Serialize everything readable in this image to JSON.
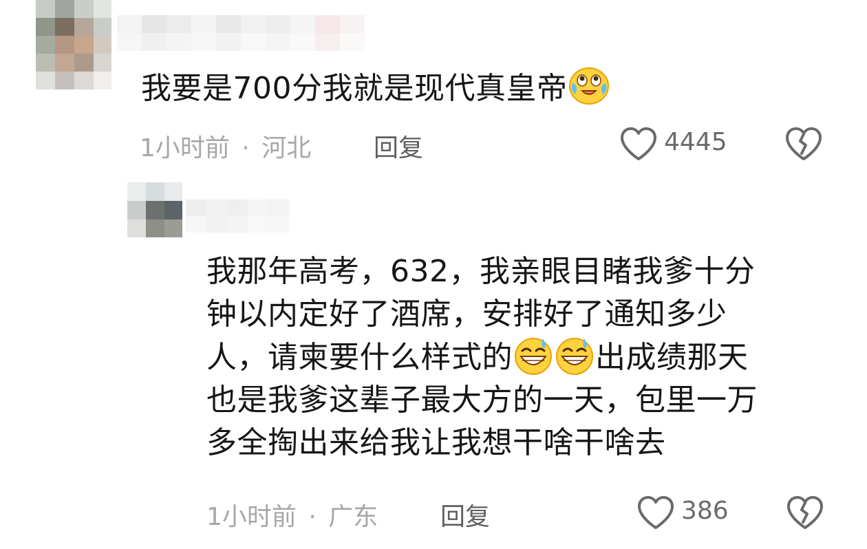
{
  "comments": [
    {
      "text_before_emoji": "我要是700分我就是现代真皇帝",
      "emoji": "laughing-crying-face",
      "time": "1小时前",
      "dot": "·",
      "location": "河北",
      "reply_label": "回复",
      "likes": "4445"
    },
    {
      "line1": "我那年高考，632，我亲眼目睹我爹十分",
      "line2": "钟以内定好了酒席，安排好了通知多少",
      "line3_before": "人，请柬要什么样式的",
      "line3_after": "出成绩那天",
      "line4": "也是我爹这辈子最大方的一天，包里一万",
      "line5": "多全掏出来给我让我想干啥干啥去",
      "emoji": "grinning-sweat-face",
      "time": "1小时前",
      "dot": "·",
      "location": "广东",
      "reply_label": "回复",
      "likes": "386"
    }
  ],
  "icons": {
    "like": "heart-outline-icon",
    "dislike": "broken-heart-icon"
  },
  "colors": {
    "text": "#161616",
    "meta": "#a7a7a7",
    "reply": "#5f5f5f",
    "icon": "#6a6a6a"
  }
}
